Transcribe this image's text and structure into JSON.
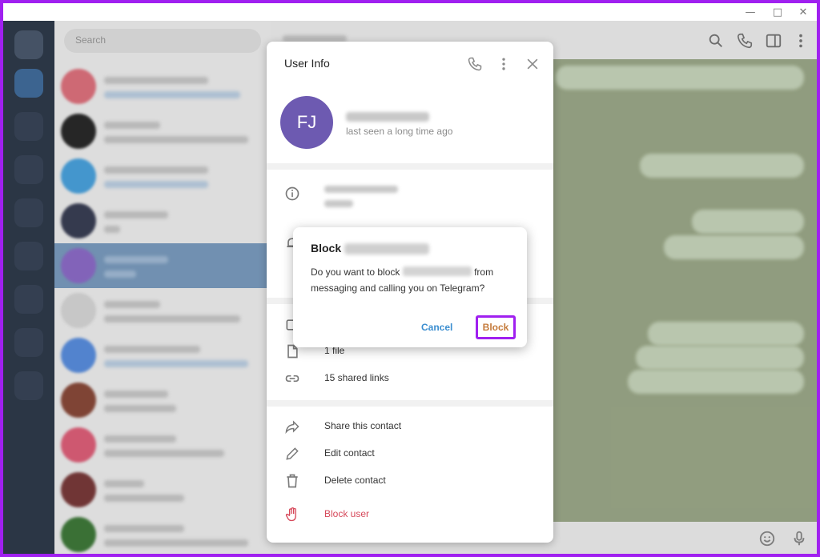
{
  "search": {
    "placeholder": "Search"
  },
  "user_info": {
    "title": "User Info",
    "initials": "FJ",
    "last_seen": "last seen a long time ago",
    "media_rows": [
      {
        "label": "1 file"
      },
      {
        "label": "15 shared links"
      }
    ],
    "actions": [
      {
        "label": "Share this contact"
      },
      {
        "label": "Edit contact"
      },
      {
        "label": "Delete contact"
      },
      {
        "label": "Block user"
      }
    ]
  },
  "dialog": {
    "title": "Block",
    "text_before": "Do you want to block ",
    "text_after": " from messaging and calling you on Telegram?",
    "cancel_label": "Cancel",
    "block_label": "Block"
  },
  "colors": {
    "accent": "#3b8ed0",
    "danger": "#d6485a",
    "highlight": "#a020f0",
    "avatar": "#6d5ab1"
  }
}
